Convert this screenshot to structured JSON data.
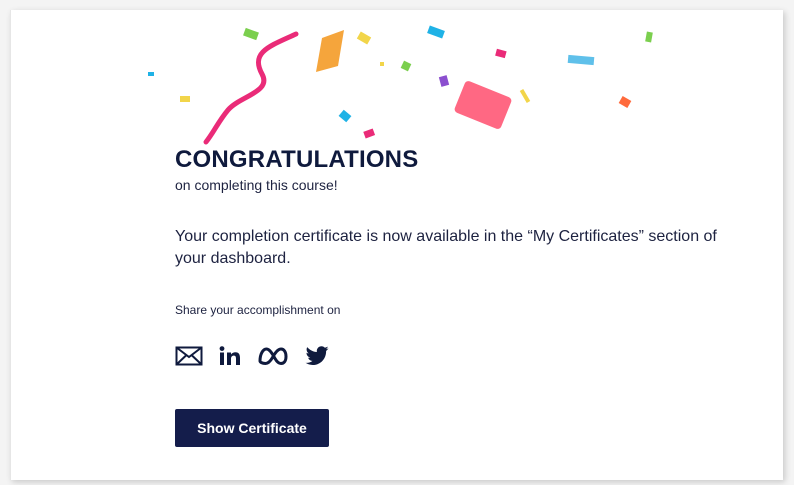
{
  "heading": {
    "title": "CONGRATULATIONS",
    "subtitle": "on completing this course!"
  },
  "message": "Your completion certificate is now available in the “My Certificates” section of your dashboard.",
  "share": {
    "label": "Share your accomplishment on",
    "icons": [
      "envelope-icon",
      "linkedin-icon",
      "meta-icon",
      "twitter-icon"
    ]
  },
  "actions": {
    "show_certificate_label": "Show Certificate"
  },
  "colors": {
    "brand_navy": "#141d4b",
    "text": "#1d2240"
  }
}
